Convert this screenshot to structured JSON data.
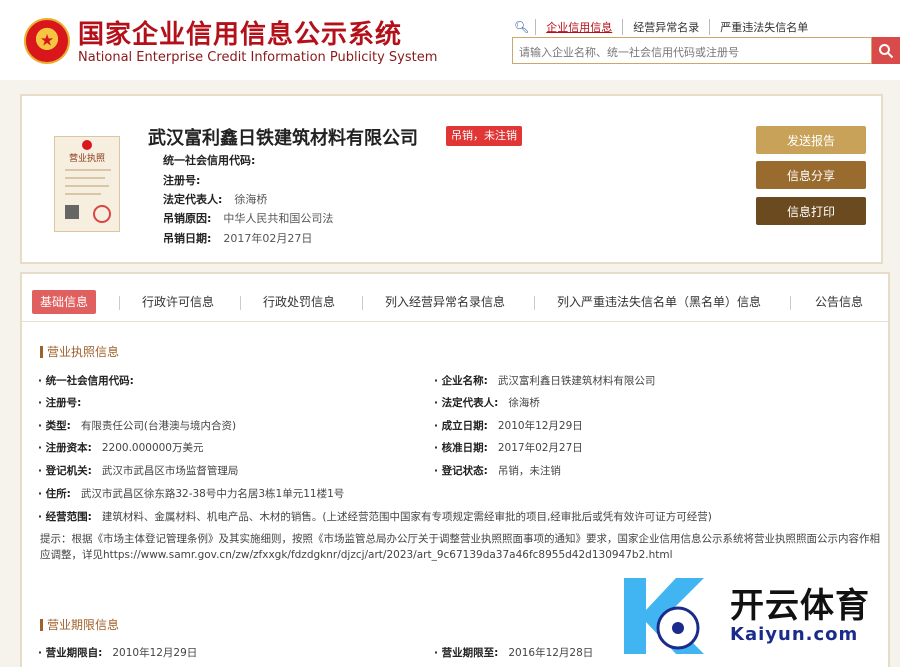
{
  "header": {
    "title_cn": "国家企业信用信息公示系统",
    "title_en": "National Enterprise Credit Information Publicity System",
    "search_tabs": [
      "企业信用信息",
      "经营异常名录",
      "严重违法失信名单"
    ],
    "search_placeholder": "请输入企业名称、统一社会信用代码或注册号"
  },
  "company": {
    "name": "武汉富利鑫日铁建筑材料有限公司",
    "status": "吊销，未注销",
    "license_title": "营业执照",
    "fields": [
      {
        "label": "统一社会信用代码:",
        "value": ""
      },
      {
        "label": "注册号:",
        "value": ""
      },
      {
        "label": "法定代表人:",
        "value": "徐海桥"
      },
      {
        "label": "吊销原因:",
        "value": "中华人民共和国公司法"
      },
      {
        "label": "吊销日期:",
        "value": "2017年02月27日"
      }
    ],
    "buttons": {
      "report": "发送报告",
      "share": "信息分享",
      "print": "信息打印"
    }
  },
  "tabs": [
    "基础信息",
    "行政许可信息",
    "行政处罚信息",
    "列入经营异常名录信息",
    "列入严重违法失信名单（黑名单）信息",
    "公告信息"
  ],
  "license_section": {
    "title": "营业执照信息",
    "left": [
      {
        "label": "· 统一社会信用代码:",
        "value": ""
      },
      {
        "label": "· 注册号:",
        "value": ""
      },
      {
        "label": "· 类型:",
        "value": "有限责任公司(台港澳与境内合资)"
      },
      {
        "label": "· 注册资本:",
        "value": "2200.000000万美元"
      },
      {
        "label": "· 登记机关:",
        "value": "武汉市武昌区市场监督管理局"
      },
      {
        "label": "· 住所:",
        "value": "武汉市武昌区徐东路32-38号中力名居3栋1单元11楼1号"
      },
      {
        "label": "· 经营范围:",
        "value": "建筑材料、金属材料、机电产品、木材的销售。(上述经营范围中国家有专项规定需经审批的项目,经审批后或凭有效许可证方可经营)"
      }
    ],
    "right": [
      {
        "label": "· 企业名称:",
        "value": "武汉富利鑫日铁建筑材料有限公司"
      },
      {
        "label": "· 法定代表人:",
        "value": "徐海桥"
      },
      {
        "label": "· 成立日期:",
        "value": "2010年12月29日"
      },
      {
        "label": "· 核准日期:",
        "value": "2017年02月27日"
      },
      {
        "label": "· 登记状态:",
        "value": "吊销，未注销"
      }
    ],
    "notice": "提示：根据《市场主体登记管理条例》及其实施细则，按照《市场监管总局办公厅关于调整营业执照照面事项的通知》要求，国家企业信用信息公示系统将营业执照照面公示内容作相应调整，详见https://www.samr.gov.cn/zw/zfxxgk/fdzdgknr/djzcj/art/2023/art_9c67139da37a46fc8955d42d130947b2.html"
  },
  "term_section": {
    "title": "营业期限信息",
    "from_label": "· 营业期限自:",
    "from_value": "2010年12月29日",
    "to_label": "· 营业期限至:",
    "to_value": "2016年12月28日"
  },
  "watermark": {
    "cn": "开云体育",
    "en": "Kaiyun.com"
  },
  "colors": {
    "brand_red": "#b3101a",
    "accent_gold": "#c9a25a",
    "tab_active": "#e06060"
  }
}
